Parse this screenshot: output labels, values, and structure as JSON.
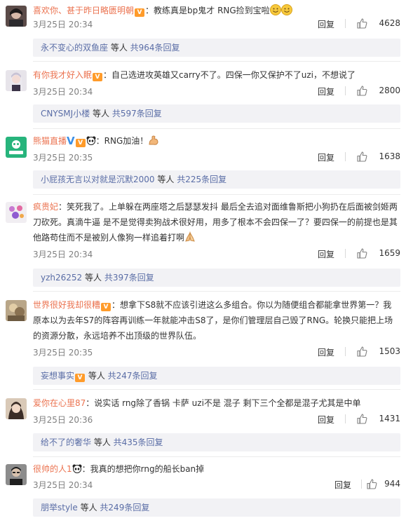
{
  "comments": [
    {
      "user": "喜欢你、甚于昨日略匮明朝",
      "text": "：教练真是bp鬼才 RNG捡到宝啦",
      "time": "3月25日 20:34",
      "reply_label": "回复",
      "likes": "4628",
      "reply_preview": {
        "name": "永不变心的双鱼座",
        "middle": " 等人 ",
        "count": "共964条回复"
      }
    },
    {
      "user": "有你我才好入眠",
      "text": "：自己选进攻英雄又carry不了。四保一你又保护不了uzi，不想说了",
      "time": "3月25日 20:34",
      "reply_label": "回复",
      "likes": "2800",
      "reply_preview": {
        "name": "CNYSMJ小楼",
        "middle": " 等人 ",
        "count": "共597条回复"
      }
    },
    {
      "user": "熊猫直播",
      "text": "：RNG加油！",
      "time": "3月25日 20:35",
      "reply_label": "回复",
      "likes": "1638",
      "reply_preview": {
        "name": "小屁孩无言以对就是沉默2000",
        "middle": " 等人 ",
        "count": "共225条回复"
      }
    },
    {
      "user": "疯贵妃",
      "text_lines": [
        "：笑死我了。上单躲在两座塔之后瑟瑟发抖 最后全去追对面维鲁斯把小狗扔在后面被剑姬两",
        "刀砍死。真滴牛逼 是不是觉得卖狗战术很好用，用多了根本不会四保一了？要四保一的前提也是其",
        "他路苟住而不是被别人像狗一样追着打啊"
      ],
      "time": "3月25日 20:34",
      "reply_label": "回复",
      "likes": "1659",
      "reply_preview": {
        "name": "yzh26252",
        "middle": " 等人 ",
        "count": "共397条回复"
      }
    },
    {
      "user": "世界很好我却很糟",
      "text_lines": [
        "：想拿下S8就不应该引进这么多组合。你以为随便组合都能拿世界第一？我",
        "原本以为去年S7的阵容再训练一年就能冲击S8了，是你们管理层自己毁了RNG。轮换只能把上场",
        "的资源分散，永远培养不出顶级的世界队伍。"
      ],
      "time": "3月25日 20:35",
      "reply_label": "回复",
      "likes": "1503",
      "reply_preview": {
        "name": "妄想事实",
        "middle": " 等人 ",
        "count": "共247条回复"
      }
    },
    {
      "user": "爱你在心里87",
      "text": "：说实话 rng除了香锅 卡萨 uzi不是 混子 剩下三个全都是混子尤其是中单",
      "time": "3月25日 20:36",
      "reply_label": "回复",
      "likes": "1431",
      "reply_preview": {
        "name": "给不了的奢华",
        "middle": " 等人 ",
        "count": "共435条回复"
      }
    },
    {
      "user": "很帅的人1",
      "text": "：我真的想把你rng的船长ban掉",
      "time": "3月25日 20:34",
      "reply_label": "回复",
      "likes": "944",
      "reply_preview": {
        "name": "朋举style",
        "middle": " 等人 ",
        "count": "共249条回复"
      }
    }
  ],
  "icons": {
    "like": "thumbs-up-icon",
    "member_badge": "vip-member-badge-icon",
    "verified": "blue-v-verified-icon",
    "panda": "panda-badge-icon",
    "smile": "smile-emoji-icon",
    "muscle": "flexed-biceps-emoji-icon",
    "hands": "praying-hands-emoji-icon"
  },
  "colors": {
    "username": "#eb7350",
    "reply_link": "#5a6da6",
    "reply_bg": "#f2f2f5",
    "meta": "#808080"
  }
}
